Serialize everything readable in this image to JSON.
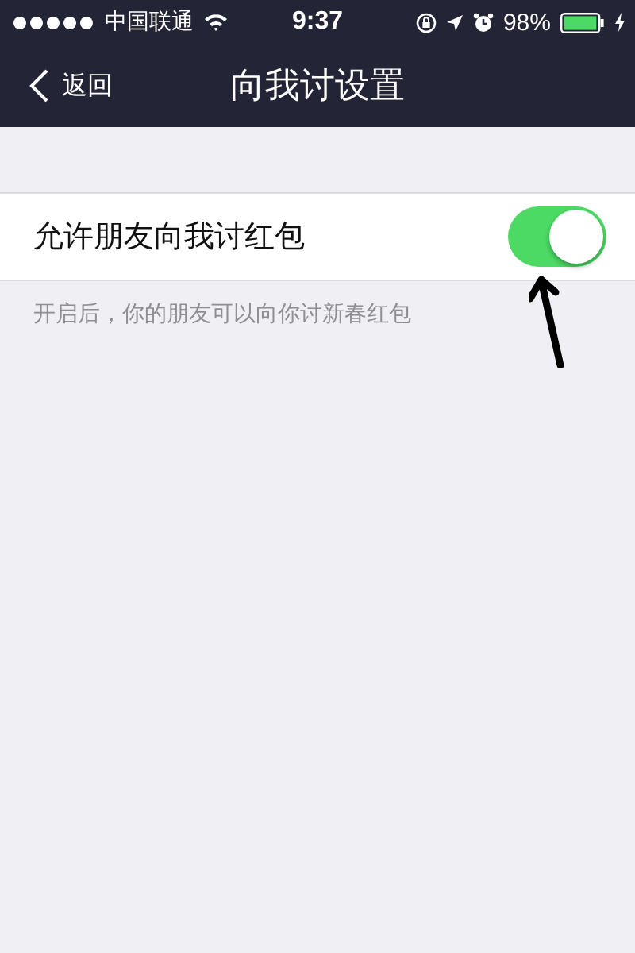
{
  "status_bar": {
    "carrier": "中国联通",
    "time": "9:37",
    "battery": "98%"
  },
  "nav_bar": {
    "back": "返回",
    "title": "向我讨设置"
  },
  "setting": {
    "label": "允许朋友向我讨红包",
    "on": true,
    "hint": "开启后，你的朋友可以向你讨新春红包"
  }
}
